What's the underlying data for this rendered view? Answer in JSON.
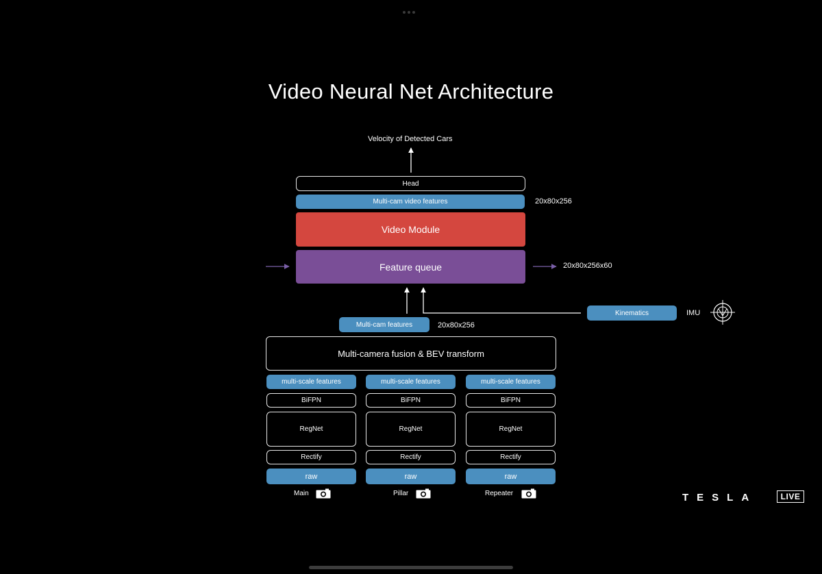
{
  "slide": {
    "title": "Video Neural Net Architecture",
    "output_label": "Velocity of Detected Cars",
    "head": "Head",
    "multicam_video_features": "Multi-cam video features",
    "multicam_video_features_dim": "20x80x256",
    "video_module": "Video Module",
    "feature_queue": "Feature queue",
    "feature_queue_dim": "20x80x256x60",
    "kinematics": "Kinematics",
    "imu": "IMU",
    "multicam_features": "Multi-cam features",
    "multicam_features_dim": "20x80x256",
    "fusion": "Multi-camera fusion & BEV transform",
    "columns": [
      {
        "features": "multi-scale features",
        "bifpn": "BiFPN",
        "regnet": "RegNet",
        "rectify": "Rectify",
        "raw": "raw",
        "camera": "Main"
      },
      {
        "features": "multi-scale features",
        "bifpn": "BiFPN",
        "regnet": "RegNet",
        "rectify": "Rectify",
        "raw": "raw",
        "camera": "Pillar"
      },
      {
        "features": "multi-scale features",
        "bifpn": "BiFPN",
        "regnet": "RegNet",
        "rectify": "Rectify",
        "raw": "raw",
        "camera": "Repeater"
      }
    ]
  },
  "branding": {
    "logo": "TESLA",
    "badge": "LIVE"
  },
  "colors": {
    "background": "#000000",
    "blue": "#4b8fbf",
    "red": "#d4473f",
    "purple": "#7a4e97"
  }
}
